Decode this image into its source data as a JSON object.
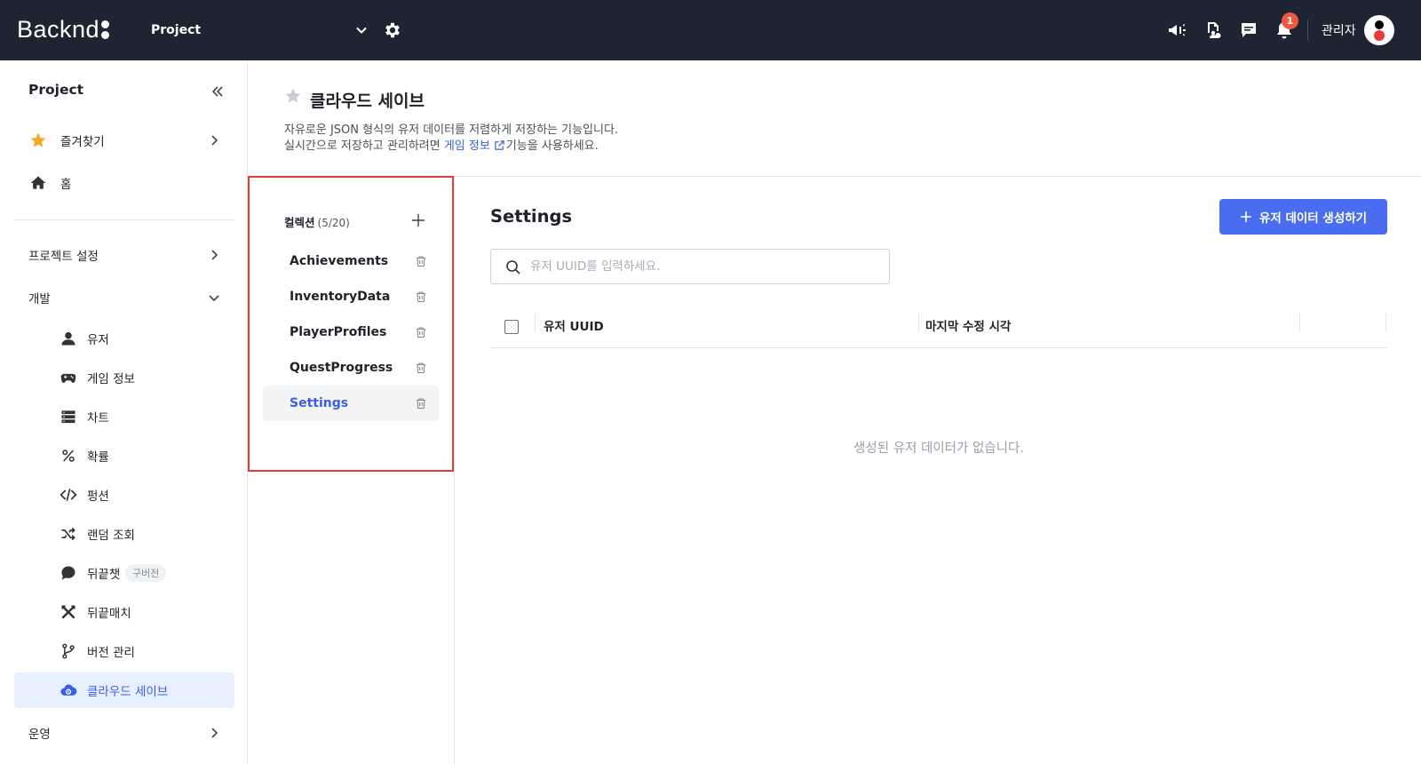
{
  "topbar": {
    "logo": "Backnd",
    "project_select": "Project",
    "notification_count": "1",
    "admin_label": "관리자"
  },
  "sidebar": {
    "project_title": "Project",
    "favorites": "즐겨찾기",
    "home": "홈",
    "project_settings": "프로젝트 설정",
    "development": "개발",
    "dev_items": [
      "유저",
      "게임 정보",
      "차트",
      "확률",
      "펑션",
      "랜덤 조회",
      "뒤끝챗",
      "뒤끝매치",
      "버전 관리",
      "클라우드 세이브"
    ],
    "old_version_tag": "구버전",
    "operation": "운영"
  },
  "page": {
    "title": "클라우드 세이브",
    "desc_line1": "자유로운 JSON 형식의 유저 데이터를 저렴하게 저장하는 기능입니다.",
    "desc_line2_pre": "실시간으로 저장하고 관리하려면 ",
    "desc_link": "게임 정보",
    "desc_line2_post": "기능을 사용하세요."
  },
  "collections": {
    "header": "컬렉션",
    "count": "(5/20)",
    "items": [
      "Achievements",
      "InventoryData",
      "PlayerProfiles",
      "QuestProgress",
      "Settings"
    ],
    "selected": "Settings"
  },
  "main": {
    "title": "Settings",
    "create_button": "유저 데이터 생성하기",
    "search_placeholder": "유저 UUID를 입력하세요.",
    "columns": [
      "유저 UUID",
      "마지막 수정 시각"
    ],
    "empty_message": "생성된 유저 데이터가 없습니다."
  },
  "colors": {
    "topbar_bg": "#1f2433",
    "accent": "#4a6cf0",
    "highlight_border": "#e63b3b",
    "badge": "#f0573f",
    "favorite_star": "#f5a623"
  }
}
